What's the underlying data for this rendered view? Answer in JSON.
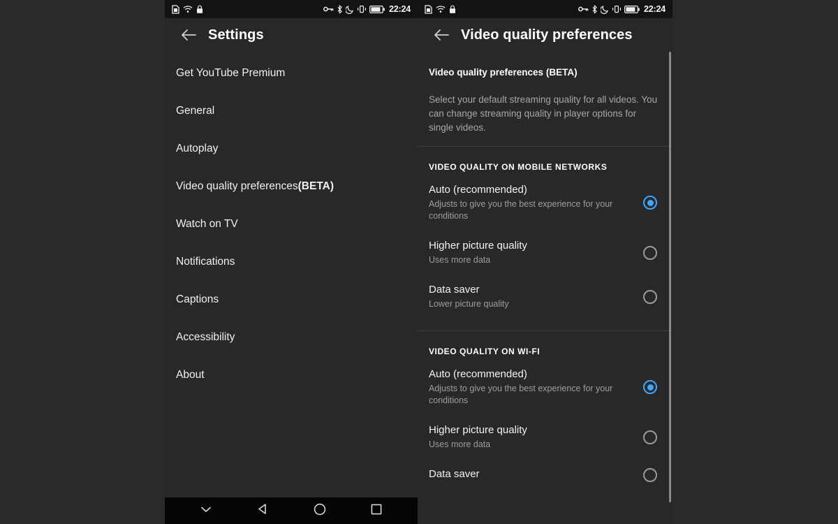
{
  "status_bar": {
    "left_icons": [
      "sim-card-icon",
      "wifi-icon",
      "lock-icon"
    ],
    "right_icons": [
      "vpn-key-icon",
      "bluetooth-icon",
      "do-not-disturb-moon-icon",
      "vibrate-icon",
      "battery-icon"
    ],
    "battery_label": "78",
    "time": "22:24"
  },
  "left_panel": {
    "back_icon": "back-arrow-icon",
    "title": "Settings",
    "items": [
      {
        "label": "Get YouTube Premium",
        "bold_suffix": ""
      },
      {
        "label": "General",
        "bold_suffix": ""
      },
      {
        "label": "Autoplay",
        "bold_suffix": ""
      },
      {
        "label": "Video quality preferences ",
        "bold_suffix": "(BETA)"
      },
      {
        "label": "Watch on TV",
        "bold_suffix": ""
      },
      {
        "label": "Notifications",
        "bold_suffix": ""
      },
      {
        "label": "Captions",
        "bold_suffix": ""
      },
      {
        "label": "Accessibility",
        "bold_suffix": ""
      },
      {
        "label": "About",
        "bold_suffix": ""
      }
    ]
  },
  "right_panel": {
    "back_icon": "back-arrow-icon",
    "title": "Video quality preferences",
    "intro": {
      "heading": "Video quality preferences ",
      "heading_bold": "(BETA)",
      "body": "Select your default streaming quality for all videos. You can change streaming quality in player options for single videos."
    },
    "sections": [
      {
        "heading": "VIDEO QUALITY ON MOBILE NETWORKS",
        "options": [
          {
            "title": "Auto (recommended)",
            "subtitle": "Adjusts to give you the best experience for your conditions",
            "selected": true
          },
          {
            "title": "Higher picture quality",
            "subtitle": "Uses more data",
            "selected": false
          },
          {
            "title": "Data saver",
            "subtitle": "Lower picture quality",
            "selected": false
          }
        ]
      },
      {
        "heading": "VIDEO QUALITY ON WI-FI",
        "options": [
          {
            "title": "Auto (recommended)",
            "subtitle": "Adjusts to give you the best experience for your conditions",
            "selected": true
          },
          {
            "title": "Higher picture quality",
            "subtitle": "Uses more data",
            "selected": false
          },
          {
            "title": "Data saver",
            "subtitle": "",
            "selected": false
          }
        ]
      }
    ]
  },
  "nav_bar": {
    "buttons": [
      {
        "icon": "chevron-down-icon",
        "name": "hide-keyboard-button"
      },
      {
        "icon": "back-triangle-icon",
        "name": "android-back-button"
      },
      {
        "icon": "home-circle-icon",
        "name": "android-home-button"
      },
      {
        "icon": "recents-square-icon",
        "name": "android-recents-button"
      }
    ]
  },
  "colors": {
    "accent": "#3ea6ff",
    "panel_bg": "#282828",
    "status_bg": "#131313",
    "nav_bg": "#050505",
    "divider": "#3d3d3d"
  }
}
